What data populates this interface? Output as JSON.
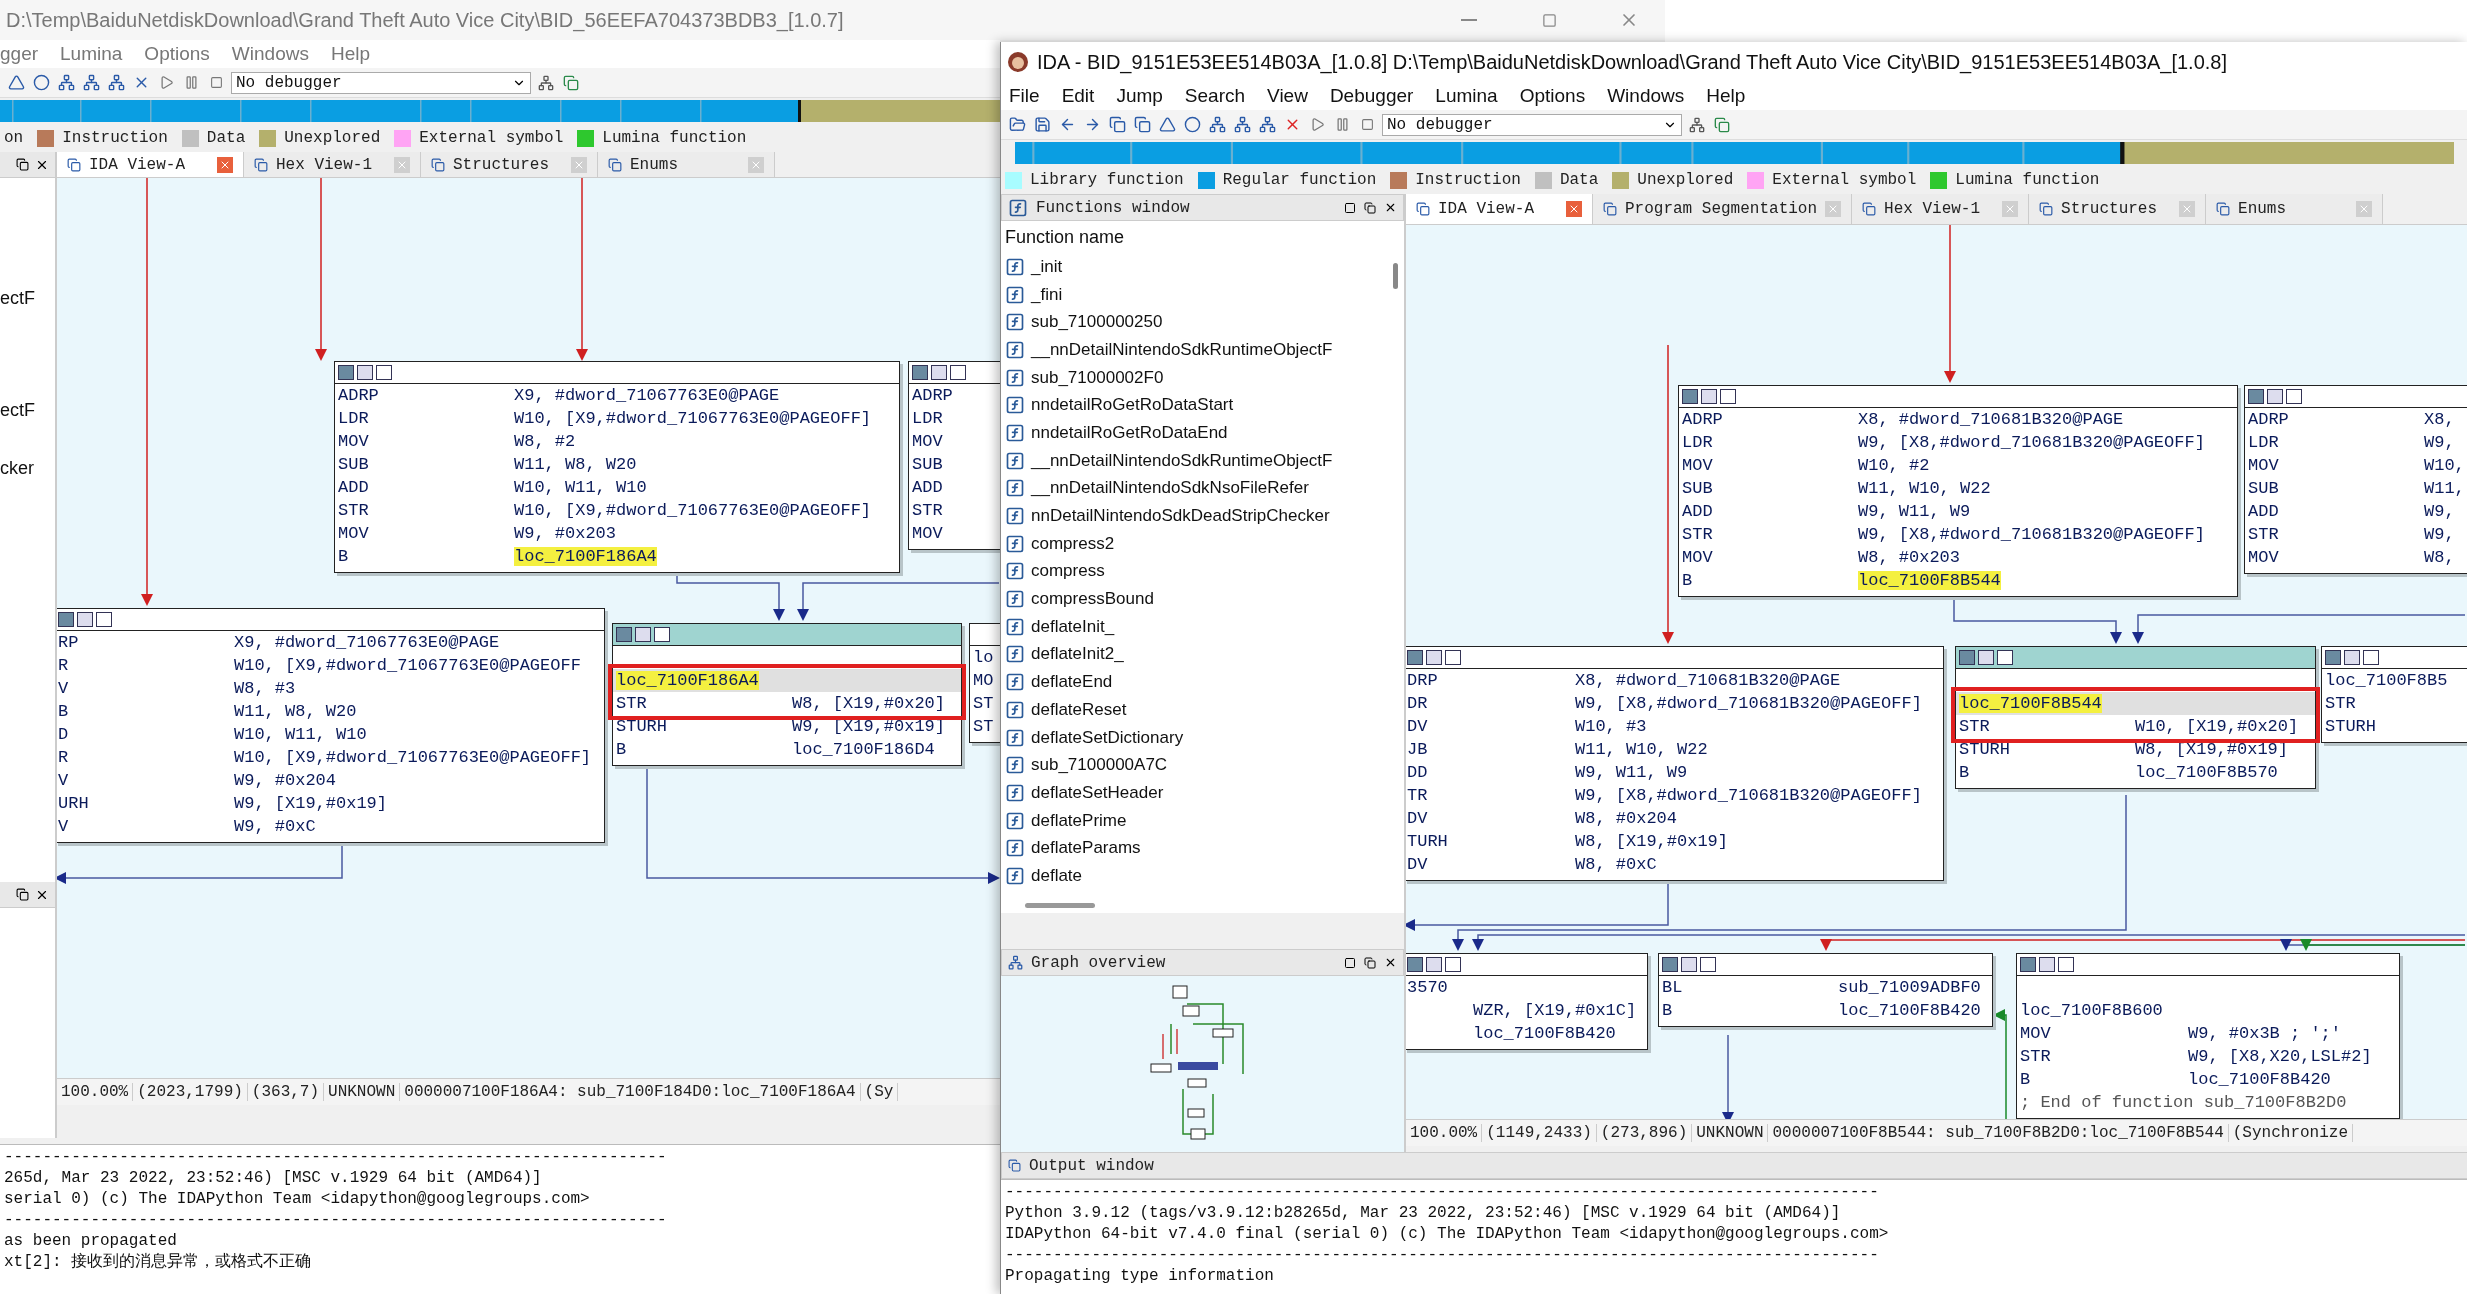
{
  "back_window": {
    "title": "D:\\Temp\\BaiduNetdiskDownload\\Grand Theft Auto Vice City\\BID_56EEFA704373BDB3_[1.0.7]",
    "menu": [
      "gger",
      "Lumina",
      "Options",
      "Windows",
      "Help"
    ],
    "debugger": "No debugger",
    "legend": [
      {
        "label": "on"
      },
      {
        "label": "Instruction",
        "color": "#b87a5a"
      },
      {
        "label": "Data",
        "color": "#c0c0c0"
      },
      {
        "label": "Unexplored",
        "color": "#b4b06c"
      },
      {
        "label": "External symbol",
        "color": "#ffa4f4"
      },
      {
        "label": "Lumina function",
        "color": "#2ec82e"
      }
    ],
    "side_items": [
      "ectF",
      "ectF",
      "cker"
    ],
    "tabs": [
      {
        "label": "IDA View-A",
        "selected": true
      },
      {
        "label": "Hex View-1",
        "selected": false
      },
      {
        "label": "Structures",
        "selected": false
      },
      {
        "label": "Enums",
        "selected": false
      }
    ],
    "nodes": [
      {
        "selected": false,
        "lines": [
          {
            "op": "ADRP",
            "arg": "X9, #dword_71067763E0@PAGE"
          },
          {
            "op": "LDR",
            "arg": "W10, [X9,#dword_71067763E0@PAGEOFF]"
          },
          {
            "op": "MOV",
            "arg": "W8, #2"
          },
          {
            "op": "SUB",
            "arg": "W11, W8, W20"
          },
          {
            "op": "ADD",
            "arg": "W10, W11, W10"
          },
          {
            "op": "STR",
            "arg": "W10, [X9,#dword_71067763E0@PAGEOFF]"
          },
          {
            "op": "MOV",
            "arg": "W9, #0x203"
          },
          {
            "op": "B",
            "arg": "loc_7100F186A4",
            "highlight": true
          }
        ]
      },
      {
        "selected": false,
        "lines": [
          {
            "op": "RP",
            "arg": "X9, #dword_71067763E0@PAGE"
          },
          {
            "op": "R",
            "arg": "W10, [X9,#dword_71067763E0@PAGEOFF"
          },
          {
            "op": "V",
            "arg": "W8, #3"
          },
          {
            "op": "B",
            "arg": "W11, W8, W20"
          },
          {
            "op": "D",
            "arg": "W10, W11, W10"
          },
          {
            "op": "R",
            "arg": "W10, [X9,#dword_71067763E0@PAGEOFF]"
          },
          {
            "op": "V",
            "arg": "W9, #0x204"
          },
          {
            "op": "URH",
            "arg": "W9, [X19,#0x19]"
          },
          {
            "op": "V",
            "arg": "W9, #0xC"
          }
        ]
      },
      {
        "selected": true,
        "lines": [
          {
            "label": "loc_7100F186A4",
            "highlight": true,
            "current": true,
            "marked": true
          },
          {
            "op": "STR",
            "arg": "W8, [X19,#0x20]",
            "marked": true
          },
          {
            "op": "STURH",
            "arg": "W9, [X19,#0x19]"
          },
          {
            "op": "B",
            "arg": "loc_7100F186D4"
          }
        ]
      },
      {
        "selected": false,
        "lines": [
          {
            "op": "ADRP"
          },
          {
            "op": "LDR"
          },
          {
            "op": "MOV"
          },
          {
            "op": "SUB"
          },
          {
            "op": "ADD"
          },
          {
            "op": "STR"
          },
          {
            "op": "MOV"
          }
        ]
      },
      {
        "selected": false,
        "lines": [
          {
            "op": "lo"
          },
          {
            "op": "MO"
          },
          {
            "op": "ST"
          },
          {
            "op": "ST"
          }
        ]
      }
    ],
    "status": [
      "100.00%",
      "(2023,1799)",
      "(363,7)",
      "UNKNOWN",
      "0000007100F186A4: sub_7100F184D0:loc_7100F186A4",
      "(Sy"
    ],
    "output": [
      "---------------------------------------------------------------------",
      "265d, Mar 23 2022, 23:52:46) [MSC v.1929 64 bit (AMD64)]",
      "serial 0) (c) The IDAPython Team <idapython@googlegroups.com>",
      "---------------------------------------------------------------------",
      "as been propagated",
      "xt[2]: 接收到的消息异常，或格式不正确"
    ]
  },
  "front_window": {
    "title": "IDA - BID_9151E53EE514B03A_[1.0.8] D:\\Temp\\BaiduNetdiskDownload\\Grand Theft Auto Vice City\\BID_9151E53EE514B03A_[1.0.8]",
    "menu": [
      "File",
      "Edit",
      "Jump",
      "Search",
      "View",
      "Debugger",
      "Lumina",
      "Options",
      "Windows",
      "Help"
    ],
    "debugger": "No debugger",
    "legend": [
      {
        "label": "Library function",
        "color": "#a8fcff"
      },
      {
        "label": "Regular function",
        "color": "#0a9ee2"
      },
      {
        "label": "Instruction",
        "color": "#b87a5a"
      },
      {
        "label": "Data",
        "color": "#c0c0c0"
      },
      {
        "label": "Unexplored",
        "color": "#b4b06c"
      },
      {
        "label": "External symbol",
        "color": "#ffa4f4"
      },
      {
        "label": "Lumina function",
        "color": "#2ec82e"
      }
    ],
    "functions_window": {
      "title": "Functions window",
      "column": "Function name",
      "items": [
        "_init",
        "_fini",
        "sub_7100000250",
        "__nnDetailNintendoSdkRuntimeObjectF",
        "sub_71000002F0",
        "nndetailRoGetRoDataStart",
        "nndetailRoGetRoDataEnd",
        "__nnDetailNintendoSdkRuntimeObjectF",
        "__nnDetailNintendoSdkNsoFileRefer",
        "nnDetailNintendoSdkDeadStripChecker",
        "compress2",
        "compress",
        "compressBound",
        "deflateInit_",
        "deflateInit2_",
        "deflateEnd",
        "deflateReset",
        "deflateSetDictionary",
        "sub_7100000A7C",
        "deflateSetHeader",
        "deflatePrime",
        "deflateParams",
        "deflate"
      ]
    },
    "graph_overview": {
      "title": "Graph overview"
    },
    "tabs": [
      {
        "label": "IDA View-A",
        "selected": true
      },
      {
        "label": "Program Segmentation",
        "selected": false
      },
      {
        "label": "Hex View-1",
        "selected": false
      },
      {
        "label": "Structures",
        "selected": false
      },
      {
        "label": "Enums",
        "selected": false
      }
    ],
    "nodes": [
      {
        "selected": false,
        "lines": [
          {
            "op": "ADRP",
            "arg": "X8, #dword_710681B320@PAGE"
          },
          {
            "op": "LDR",
            "arg": "W9, [X8,#dword_710681B320@PAGEOFF]"
          },
          {
            "op": "MOV",
            "arg": "W10, #2"
          },
          {
            "op": "SUB",
            "arg": "W11, W10, W22"
          },
          {
            "op": "ADD",
            "arg": "W9, W11, W9"
          },
          {
            "op": "STR",
            "arg": "W9, [X8,#dword_710681B320@PAGEOFF]"
          },
          {
            "op": "MOV",
            "arg": "W8, #0x203"
          },
          {
            "op": "B",
            "arg": "loc_7100F8B544",
            "highlight": true
          }
        ]
      },
      {
        "selected": false,
        "lines": [
          {
            "op": "ADRP",
            "arg": "X8,"
          },
          {
            "op": "LDR",
            "arg": "W9,"
          },
          {
            "op": "MOV",
            "arg": "W10,"
          },
          {
            "op": "SUB",
            "arg": "W11,"
          },
          {
            "op": "ADD",
            "arg": "W9,"
          },
          {
            "op": "STR",
            "arg": "W9,"
          },
          {
            "op": "MOV",
            "arg": "W8,"
          }
        ]
      },
      {
        "selected": false,
        "lines": [
          {
            "op": "DRP",
            "arg": "X8, #dword_710681B320@PAGE"
          },
          {
            "op": "DR",
            "arg": "W9, [X8,#dword_710681B320@PAGEOFF]"
          },
          {
            "op": "DV",
            "arg": "W10, #3"
          },
          {
            "op": "JB",
            "arg": "W11, W10, W22"
          },
          {
            "op": "DD",
            "arg": "W9, W11, W9"
          },
          {
            "op": "TR",
            "arg": "W9, [X8,#dword_710681B320@PAGEOFF]"
          },
          {
            "op": "DV",
            "arg": "W8, #0x204"
          },
          {
            "op": "TURH",
            "arg": "W8, [X19,#0x19]"
          },
          {
            "op": "DV",
            "arg": "W8, #0xC"
          }
        ]
      },
      {
        "selected": true,
        "lines": [
          {
            "label": "loc_7100F8B544",
            "highlight": true,
            "current": true,
            "marked": true
          },
          {
            "op": "STR",
            "arg": "W10, [X19,#0x20]",
            "marked": true
          },
          {
            "op": "STURH",
            "arg": "W8, [X19,#0x19]"
          },
          {
            "op": "B",
            "arg": "loc_7100F8B570"
          }
        ]
      },
      {
        "selected": false,
        "lines": [
          {
            "label": "loc_7100F8B5"
          },
          {
            "op": "STR"
          },
          {
            "op": "STURH"
          }
        ]
      },
      {
        "selected": false,
        "lines": [
          {
            "label": "3570"
          },
          {
            "arg": "WZR, [X19,#0x1C]"
          },
          {
            "arg": "loc_7100F8B420"
          }
        ]
      },
      {
        "selected": false,
        "lines": [
          {
            "op": "BL",
            "arg": "sub_71009ADBF0"
          },
          {
            "op": "B",
            "arg": "loc_7100F8B420"
          }
        ]
      },
      {
        "selected": false,
        "lines": [
          {
            "label": "loc_7100F8B600"
          },
          {
            "op": "MOV",
            "arg": "W9, #0x3B ; ';'"
          },
          {
            "op": "STR",
            "arg": "W9, [X8,X20,LSL#2]"
          },
          {
            "op": "B",
            "arg": "loc_7100F8B420"
          },
          {
            "comment": "; End of function sub_7100F8B2D0"
          }
        ]
      }
    ],
    "status": [
      "100.00%",
      "(1149,2433)",
      "(273,896)",
      "UNKNOWN",
      "0000007100F8B544: sub_7100F8B2D0:loc_7100F8B544",
      "(Synchronize"
    ],
    "output_window": {
      "title": "Output window",
      "lines": [
        "-------------------------------------------------------------------------------------------",
        "Python 3.9.12 (tags/v3.9.12:b28265d, Mar 23 2022, 23:52:46) [MSC v.1929 64 bit (AMD64)]",
        "IDAPython 64-bit v7.4.0 final (serial 0) (c) The IDAPython Team <idapython@googlegroups.com>",
        "-------------------------------------------------------------------------------------------",
        "Propagating type information"
      ]
    }
  }
}
